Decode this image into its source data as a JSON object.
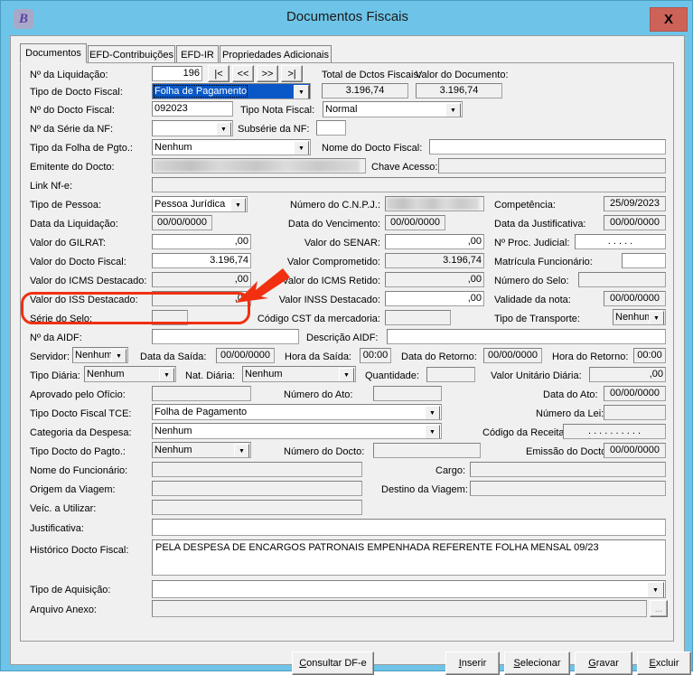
{
  "window": {
    "title": "Documentos Fiscais",
    "app_icon": "B",
    "close_label": "X",
    "border_color": "#6ec4e8",
    "close_color": "#cd6358"
  },
  "tabs": [
    {
      "label": "Documentos",
      "active": true
    },
    {
      "label": "EFD-Contribuições",
      "active": false
    },
    {
      "label": "EFD-IR",
      "active": false
    },
    {
      "label": "Propriedades Adicionais",
      "active": false
    }
  ],
  "nav_buttons": [
    {
      "label": "|<",
      "name": "first-record-button"
    },
    {
      "label": "<<",
      "name": "previous-record-button"
    },
    {
      "label": ">>",
      "name": "next-record-button"
    },
    {
      "label": ">|",
      "name": "last-record-button"
    }
  ],
  "fields": {
    "num_liquidacao": {
      "label": "Nº da Liquidação:",
      "value": "196"
    },
    "total_dctos": {
      "label": "Total de Dctos Fiscais:",
      "value": "3.196,74"
    },
    "valor_documento": {
      "label": "Valor do Documento:",
      "value": "3.196,74"
    },
    "tipo_docto_fiscal": {
      "label": "Tipo de Docto Fiscal:",
      "value": "Folha de Pagamento"
    },
    "num_docto_fiscal": {
      "label": "Nº do Docto Fiscal:",
      "value": "092023"
    },
    "tipo_nota_fiscal": {
      "label": "Tipo Nota Fiscal:",
      "value": "Normal"
    },
    "num_serie_nf": {
      "label": "Nº da Série da NF:",
      "value": ""
    },
    "subserie_nf": {
      "label": "Subsérie da NF:",
      "value": ""
    },
    "tipo_folha_pgto": {
      "label": "Tipo da Folha de Pgto.:",
      "value": "Nenhum"
    },
    "nome_docto_fiscal": {
      "label": "Nome do Docto Fiscal:",
      "value": ""
    },
    "emitente_docto": {
      "label": "Emitente do Docto:",
      "value": ""
    },
    "chave_acesso": {
      "label": "Chave Acesso:",
      "value": ""
    },
    "link_nfe": {
      "label": "Link Nf-e:",
      "value": ""
    },
    "tipo_pessoa": {
      "label": "Tipo de Pessoa:",
      "value": "Pessoa Jurídica"
    },
    "numero_cnpj": {
      "label": "Número do  C.N.P.J.:",
      "value": ""
    },
    "competencia": {
      "label": "Competência:",
      "value": "25/09/2023"
    },
    "data_liquidacao": {
      "label": "Data da Liquidação:",
      "value": "00/00/0000"
    },
    "data_vencimento": {
      "label": "Data do Vencimento:",
      "value": "00/00/0000"
    },
    "data_justificativa": {
      "label": "Data da Justificativa:",
      "value": "00/00/0000"
    },
    "valor_gilrat": {
      "label": "Valor do GILRAT:",
      "value": ",00"
    },
    "valor_senar": {
      "label": "Valor do SENAR:",
      "value": ",00"
    },
    "num_proc_judicial": {
      "label": "Nº Proc. Judicial:",
      "value": ".   .  . . ."
    },
    "valor_docto_fiscal": {
      "label": "Valor do Docto Fiscal:",
      "value": "3.196,74"
    },
    "valor_comprometido": {
      "label": "Valor Comprometido:",
      "value": "3.196,74"
    },
    "matricula_funcionario": {
      "label": "Matrícula Funcionário:",
      "value": ""
    },
    "valor_icms_destacado": {
      "label": "Valor do ICMS Destacado:",
      "value": ",00"
    },
    "valor_icms_retido": {
      "label": "Valor do ICMS Retido:",
      "value": ",00"
    },
    "numero_selo": {
      "label": "Número do Selo:",
      "value": ""
    },
    "valor_iss_destacado": {
      "label": "Valor do ISS Destacado:",
      "value": ",00"
    },
    "valor_inss_destacado": {
      "label": "Valor INSS Destacado:",
      "value": ",00"
    },
    "validade_nota": {
      "label": "Validade da nota:",
      "value": "00/00/0000"
    },
    "serie_selo": {
      "label": "Série do Selo:",
      "value": ""
    },
    "codigo_cst": {
      "label": "Código CST da mercadoria:",
      "value": ""
    },
    "tipo_transporte": {
      "label": "Tipo de Transporte:",
      "value": "Nenhum"
    },
    "num_aidf": {
      "label": "Nº da AIDF:",
      "value": ""
    },
    "descricao_aidf": {
      "label": "Descrição AIDF:",
      "value": ""
    },
    "servidor": {
      "label": "Servidor:",
      "value": "Nenhum"
    },
    "data_saida": {
      "label": "Data da Saída:",
      "value": "00/00/0000"
    },
    "hora_saida": {
      "label": "Hora da Saída:",
      "value": "00:00"
    },
    "data_retorno": {
      "label": "Data do Retorno:",
      "value": "00/00/0000"
    },
    "hora_retorno": {
      "label": "Hora do Retorno:",
      "value": "00:00"
    },
    "tipo_diaria": {
      "label": "Tipo Diária:",
      "value": "Nenhum"
    },
    "nat_diaria": {
      "label": "Nat. Diária:",
      "value": "Nenhum"
    },
    "quantidade": {
      "label": "Quantidade:",
      "value": ""
    },
    "valor_unitario_diaria": {
      "label": "Valor Unitário Diária:",
      "value": ",00"
    },
    "aprovado_oficio": {
      "label": "Aprovado pelo Ofício:",
      "value": ""
    },
    "numero_ato": {
      "label": "Número do Ato:",
      "value": ""
    },
    "data_ato": {
      "label": "Data do Ato:",
      "value": "00/00/0000"
    },
    "tipo_docto_fiscal_tce": {
      "label": "Tipo Docto Fiscal TCE:",
      "value": "Folha de Pagamento"
    },
    "numero_lei": {
      "label": "Número da Lei:",
      "value": ""
    },
    "categoria_despesa": {
      "label": "Categoria da Despesa:",
      "value": "Nenhum"
    },
    "codigo_receita": {
      "label": "Código da Receita:",
      "value": ". . . . .  . . . . ."
    },
    "tipo_docto_pagto": {
      "label": "Tipo Docto do Pagto.:",
      "value": "Nenhum"
    },
    "numero_docto": {
      "label": "Número do Docto:",
      "value": ""
    },
    "emissao_docto": {
      "label": "Emissão do Docto:",
      "value": "00/00/0000"
    },
    "nome_funcionario": {
      "label": "Nome do Funcionário:",
      "value": ""
    },
    "cargo": {
      "label": "Cargo:",
      "value": ""
    },
    "origem_viagem": {
      "label": "Origem da Viagem:",
      "value": ""
    },
    "destino_viagem": {
      "label": "Destino da Viagem:",
      "value": ""
    },
    "veic_utilizar": {
      "label": "Veíc. a Utilizar:",
      "value": ""
    },
    "justificativa": {
      "label": "Justificativa:",
      "value": ""
    },
    "historico_docto_fiscal": {
      "label": "Histórico Docto Fiscal:",
      "value": "PELA DESPESA DE ENCARGOS PATRONAIS EMPENHADA REFERENTE FOLHA MENSAL 09/23"
    },
    "tipo_aquisicao": {
      "label": "Tipo de Aquisição:",
      "value": ""
    },
    "arquivo_anexo": {
      "label": "Arquivo Anexo:",
      "value": ""
    }
  },
  "buttons": {
    "consultar_dfe": "Consultar DF-e",
    "inserir": "Inserir",
    "selecionar": "Selecionar",
    "gravar": "Gravar",
    "excluir": "Excluir"
  },
  "annotation": {
    "highlight_color": "#f03010",
    "target_field": "Valor do ISS Destacado"
  }
}
